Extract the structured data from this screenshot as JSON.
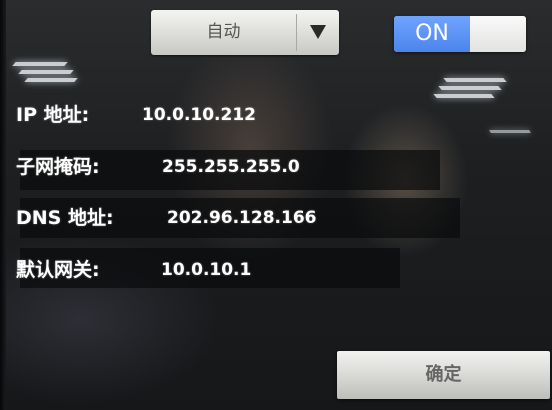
{
  "mode_dropdown": {
    "selected": "自动",
    "arrow_icon": "triangle-down-icon"
  },
  "toggle": {
    "state": "ON"
  },
  "fields": [
    {
      "label": "IP 地址:",
      "value": "10.0.10.212"
    },
    {
      "label": "子网掩码:",
      "value": "255.255.255.0"
    },
    {
      "label": "DNS 地址:",
      "value": "202.96.128.166"
    },
    {
      "label": "默认网关:",
      "value": "10.0.10.1"
    }
  ],
  "confirm_button": {
    "label": "确定"
  }
}
